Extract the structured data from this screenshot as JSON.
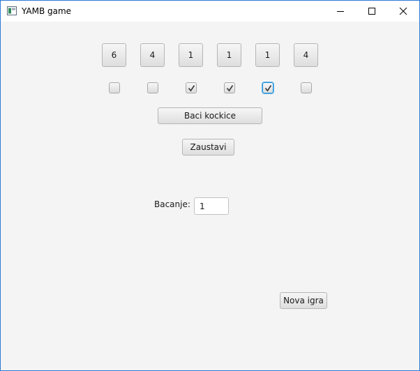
{
  "window": {
    "title": "YAMB game"
  },
  "dice": [
    {
      "value": "6",
      "held": false
    },
    {
      "value": "4",
      "held": false
    },
    {
      "value": "1",
      "held": true
    },
    {
      "value": "1",
      "held": true
    },
    {
      "value": "1",
      "held": true
    },
    {
      "value": "4",
      "held": false
    }
  ],
  "controls": {
    "roll_label": "Baci kockice",
    "stop_label": "Zaustavi",
    "new_game_label": "Nova igra"
  },
  "throw": {
    "label": "Bacanje:",
    "value": "1"
  }
}
